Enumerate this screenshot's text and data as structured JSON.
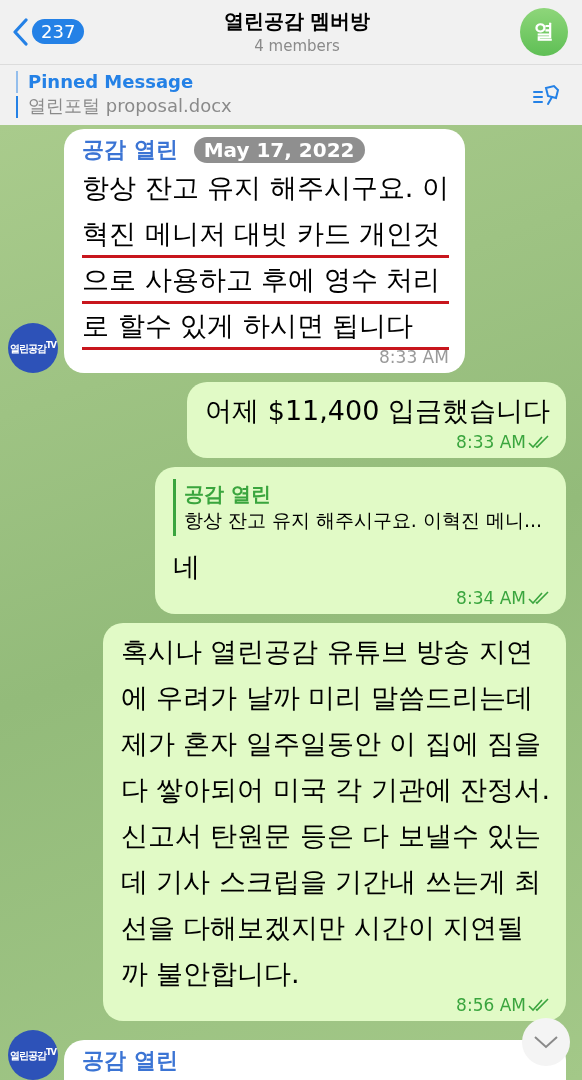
{
  "header": {
    "back_count": "237",
    "title": "열린공감 멤버방",
    "subtitle": "4 members",
    "avatar_letter": "열"
  },
  "pinned": {
    "label": "Pinned Message",
    "text": "열린포털 proposal.docx"
  },
  "date_pill": "May 17, 2022",
  "messages": [
    {
      "outgoing": false,
      "sender": "공감 열린",
      "avatar_text": "열린공감$^{TV}$",
      "lines": [
        {
          "text": "항상 잔고 유지 해주시구요. 이",
          "underlined": false
        },
        {
          "text": "혁진 메니저 대빗 카드 개인것",
          "underlined": true
        },
        {
          "text": "으로 사용하고 후에 영수 처리",
          "underlined": true
        },
        {
          "text": "로 할수 있게 하시면 됩니다",
          "underlined": true
        }
      ],
      "time": "8:33 AM"
    },
    {
      "outgoing": true,
      "read": true,
      "lines": [
        "어제 $11,400 입금했습니다"
      ],
      "time": "8:33 AM"
    },
    {
      "outgoing": true,
      "read": true,
      "reply_to": {
        "sender": "공감 열린",
        "text": "항상 잔고 유지 해주시구요. 이혁진 메니..."
      },
      "lines": [
        "네"
      ],
      "time": "8:34 AM"
    },
    {
      "outgoing": true,
      "read": true,
      "lines": [
        "혹시나 열린공감 유튜브 방송 지연",
        "에 우려가 날까 미리 말씀드리는데",
        "제가 혼자 일주일동안 이 집에 짐을",
        "다 쌓아되어 미국 각 기관에 잔정서.",
        "신고서 탄원문 등은 다 보낼수 있는",
        "데 기사 스크립을 기간내 쓰는게 최",
        "선을 다해보겠지만 시간이 지연될",
        "까 불안합니다."
      ],
      "time": "8:56 AM"
    },
    {
      "outgoing": false,
      "sender": "공감 열린",
      "avatar_text": "열린공감$^{TV}$"
    }
  ]
}
